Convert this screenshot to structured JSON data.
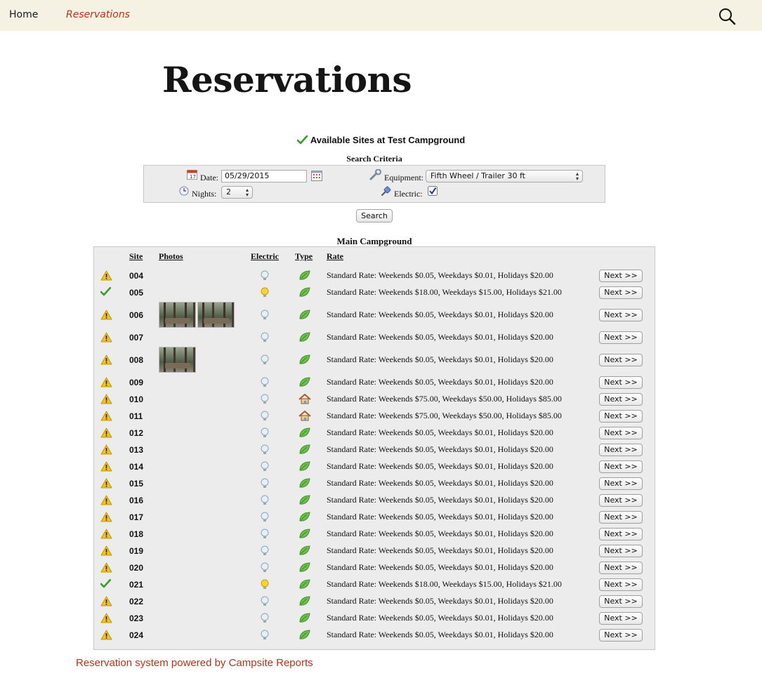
{
  "nav": {
    "home_label": "Home",
    "reservations_label": "Reservations"
  },
  "page_title": "Reservations",
  "availability_heading": "Available Sites at Test Campground",
  "search_criteria": {
    "title": "Search Criteria",
    "date_label": "Date:",
    "date_value": "05/29/2015",
    "nights_label": "Nights:",
    "nights_value": "2",
    "equipment_label": "Equipment:",
    "equipment_value": "Fifth Wheel / Trailer 30 ft",
    "electric_label": "Electric:",
    "electric_checked": true,
    "search_button": "Search"
  },
  "campground": {
    "title": "Main Campground",
    "headers": {
      "site": "Site",
      "photos": "Photos",
      "electric": "Electric",
      "type": "Type",
      "rate": "Rate"
    },
    "next_label": "Next >>",
    "rows": [
      {
        "site": "004",
        "status": "warning",
        "electric": "off",
        "type": "leaf",
        "photos": 0,
        "rate": "Standard Rate: Weekends $0.05, Weekdays $0.01, Holidays $20.00"
      },
      {
        "site": "005",
        "status": "available",
        "electric": "on",
        "type": "leaf",
        "photos": 0,
        "rate": "Standard Rate: Weekends $18.00, Weekdays $15.00, Holidays $21.00"
      },
      {
        "site": "006",
        "status": "warning",
        "electric": "off",
        "type": "leaf",
        "photos": 2,
        "rate": "Standard Rate: Weekends $0.05, Weekdays $0.01, Holidays $20.00"
      },
      {
        "site": "007",
        "status": "warning",
        "electric": "off",
        "type": "leaf",
        "photos": 0,
        "rate": "Standard Rate: Weekends $0.05, Weekdays $0.01, Holidays $20.00"
      },
      {
        "site": "008",
        "status": "warning",
        "electric": "off",
        "type": "leaf",
        "photos": 1,
        "rate": "Standard Rate: Weekends $0.05, Weekdays $0.01, Holidays $20.00"
      },
      {
        "site": "009",
        "status": "warning",
        "electric": "off",
        "type": "leaf",
        "photos": 0,
        "rate": "Standard Rate: Weekends $0.05, Weekdays $0.01, Holidays $20.00"
      },
      {
        "site": "010",
        "status": "warning",
        "electric": "off",
        "type": "house",
        "photos": 0,
        "rate": "Standard Rate: Weekends $75.00, Weekdays $50.00, Holidays $85.00"
      },
      {
        "site": "011",
        "status": "warning",
        "electric": "off",
        "type": "house",
        "photos": 0,
        "rate": "Standard Rate: Weekends $75.00, Weekdays $50.00, Holidays $85.00"
      },
      {
        "site": "012",
        "status": "warning",
        "electric": "off",
        "type": "leaf",
        "photos": 0,
        "rate": "Standard Rate: Weekends $0.05, Weekdays $0.01, Holidays $20.00"
      },
      {
        "site": "013",
        "status": "warning",
        "electric": "off",
        "type": "leaf",
        "photos": 0,
        "rate": "Standard Rate: Weekends $0.05, Weekdays $0.01, Holidays $20.00"
      },
      {
        "site": "014",
        "status": "warning",
        "electric": "off",
        "type": "leaf",
        "photos": 0,
        "rate": "Standard Rate: Weekends $0.05, Weekdays $0.01, Holidays $20.00"
      },
      {
        "site": "015",
        "status": "warning",
        "electric": "off",
        "type": "leaf",
        "photos": 0,
        "rate": "Standard Rate: Weekends $0.05, Weekdays $0.01, Holidays $20.00"
      },
      {
        "site": "016",
        "status": "warning",
        "electric": "off",
        "type": "leaf",
        "photos": 0,
        "rate": "Standard Rate: Weekends $0.05, Weekdays $0.01, Holidays $20.00"
      },
      {
        "site": "017",
        "status": "warning",
        "electric": "off",
        "type": "leaf",
        "photos": 0,
        "rate": "Standard Rate: Weekends $0.05, Weekdays $0.01, Holidays $20.00"
      },
      {
        "site": "018",
        "status": "warning",
        "electric": "off",
        "type": "leaf",
        "photos": 0,
        "rate": "Standard Rate: Weekends $0.05, Weekdays $0.01, Holidays $20.00"
      },
      {
        "site": "019",
        "status": "warning",
        "electric": "off",
        "type": "leaf",
        "photos": 0,
        "rate": "Standard Rate: Weekends $0.05, Weekdays $0.01, Holidays $20.00"
      },
      {
        "site": "020",
        "status": "warning",
        "electric": "off",
        "type": "leaf",
        "photos": 0,
        "rate": "Standard Rate: Weekends $0.05, Weekdays $0.01, Holidays $20.00"
      },
      {
        "site": "021",
        "status": "available",
        "electric": "on",
        "type": "leaf",
        "photos": 0,
        "rate": "Standard Rate: Weekends $18.00, Weekdays $15.00, Holidays $21.00"
      },
      {
        "site": "022",
        "status": "warning",
        "electric": "off",
        "type": "leaf",
        "photos": 0,
        "rate": "Standard Rate: Weekends $0.05, Weekdays $0.01, Holidays $20.00"
      },
      {
        "site": "023",
        "status": "warning",
        "electric": "off",
        "type": "leaf",
        "photos": 0,
        "rate": "Standard Rate: Weekends $0.05, Weekdays $0.01, Holidays $20.00"
      },
      {
        "site": "024",
        "status": "warning",
        "electric": "off",
        "type": "leaf",
        "photos": 0,
        "rate": "Standard Rate: Weekends $0.05, Weekdays $0.01, Holidays $20.00"
      }
    ]
  },
  "footer_link": "Reservation system powered by Campsite Reports",
  "colors": {
    "accent": "#b3341b",
    "nav_bg": "#f5f2e4",
    "panel_bg": "#ececec"
  }
}
